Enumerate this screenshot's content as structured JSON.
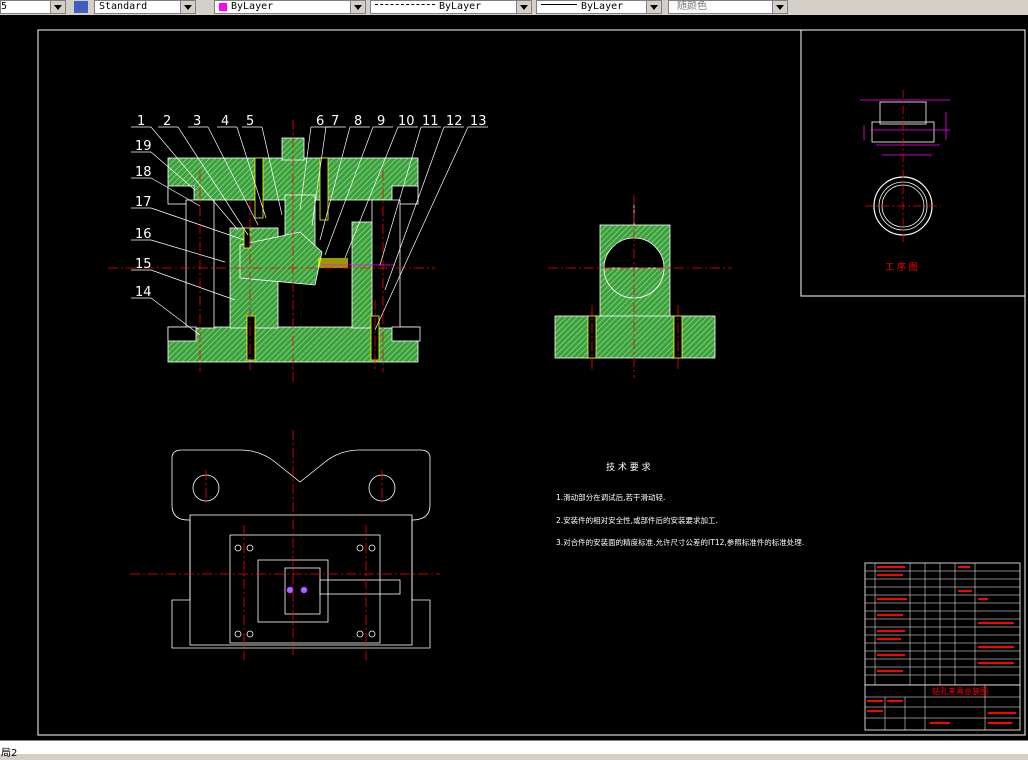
{
  "toolbar": {
    "left_fragment": "5",
    "text_style": "Standard",
    "color_control": "ByLayer",
    "linetype_control": "ByLayer",
    "lineweight_control": "ByLayer",
    "plot_style": "随颜色",
    "colors": {
      "bylayer_swatch": "#ff00ff"
    }
  },
  "drawing": {
    "part_numbers": [
      "1",
      "2",
      "3",
      "4",
      "5",
      "6",
      "7",
      "8",
      "9",
      "10",
      "11",
      "12",
      "13",
      "19",
      "18",
      "17",
      "16",
      "15",
      "14"
    ],
    "tech_title": "技 术 要 求",
    "tech_notes": [
      "1.滑动部分在调试后,若干滑动轻.",
      "2.安装件的相对安全性,或部件后的安装要求加工.",
      "3.对合件的安装面的精度标准.允许尺寸公差的IT12,参照标准件的标准处理."
    ],
    "process_label": "工 序 图",
    "title_block_name": "钻孔夹具总装图"
  },
  "layout_tab": "局2"
}
